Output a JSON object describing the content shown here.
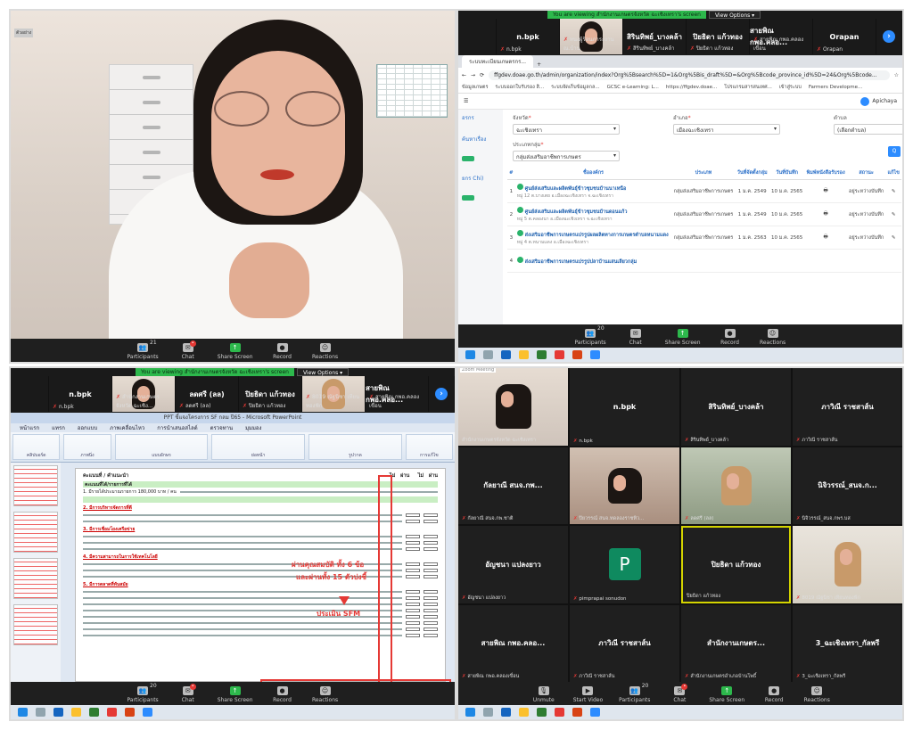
{
  "banner": {
    "sharing_text": "You are viewing สำนักงานเกษตรจังหวัด ฉะเชิงเทรา's screen",
    "view_options": "View Options ▾"
  },
  "zoom_controls": {
    "participants": "Participants",
    "chat": "Chat",
    "share_screen": "Share Screen",
    "record": "Record",
    "reactions": "Reactions",
    "q1_count": "21",
    "q2_count": "20",
    "q3_count": "20",
    "q4_count": "20",
    "start_video": "Start Video",
    "unmute": "Unmute"
  },
  "q1": {
    "tag": "ตัวอย่าง",
    "name_tag": "Hanna"
  },
  "q2": {
    "strip": [
      {
        "name": "",
        "sub": "ทนงผู้ร้อนภาระงาน ณ.บ้าน"
      },
      {
        "name": "n.bpk",
        "sub": "n.bpk"
      },
      {
        "name": "สิรินทิพย์_บางคล้า",
        "sub": "สิรินทิพย์_บางคล้า"
      },
      {
        "name": "ปิยธิดา แก้วทอง",
        "sub": "ปิยธิดา แก้วทอง"
      },
      {
        "name": "สายพิณ กพอ.คลอ...",
        "sub": "สายพิณ กพอ.คลองเขื่อน"
      },
      {
        "name": "Orapan",
        "sub": "Orapan"
      }
    ],
    "tab_title": "ระบบทะเบียนเกษตรกร...",
    "url": "ffgdev.doae.go.th/admin/organization/index?Org%5Bsearch%5D=1&Org%5Bis_draft%5D=&Org%5Bcode_province_id%5D=24&Org%5Bcode...",
    "bookmarks": [
      "ข้อมูลเกษตร",
      "ระบบออกใบรับรอง สิ...",
      "ระบบจัดเก็บข้อมูลกล...",
      "GCSC e-Learning: L...",
      "https://ffgdev.doae...",
      "โปรแกรมสารสนเทศ...",
      "เข้าสู่ระบบ",
      "Farmers Developme..."
    ],
    "user_name": "Apichaya",
    "user_role": "กษตร ฉะเชิงเทรา",
    "sidebar": [
      "อรกร",
      "ค้นหาเรื่อง",
      "ยกร Chi)"
    ],
    "labels": {
      "province": "จังหวัด",
      "district": "อำเภอ",
      "subdistrict": "ตำบล",
      "group_type": "ประเภทกลุ่ม"
    },
    "values": {
      "province": "ฉะเชิงเทรา",
      "district": "เมืองฉะเชิงเทรา",
      "subdistrict": "(เลือกตำบล)",
      "group_type": "กลุ่มส่งเสริมอาชีพการเกษตร"
    },
    "search_btn": "Q",
    "headers": [
      "#",
      "ชื่อองค์กร",
      "ประเภท",
      "วันที่จัดตั้งกลุ่ม",
      "วันที่บันทึก",
      "พิมพ์หนังสือรับรอง",
      "สถานะ",
      "แก้ไข"
    ],
    "rows": [
      {
        "no": "1",
        "name": "ศูนย์ส่งเสริมและผลิตพันธุ์ข้าวชุมชนบ้านนาเหนือ",
        "addr": "หมู่ 12 ต.บางเตย อ.เมืองฉะเชิงเทรา จ.ฉะเชิงเทรา",
        "type": "กลุ่มส่งเสริมอาชีพการเกษตร",
        "est": "1 ม.ค. 2549",
        "saved": "10 ม.ค. 2565",
        "status": "อยู่ระหว่างบันทึก"
      },
      {
        "no": "2",
        "name": "ศูนย์ส่งเสริมและผลิตพันธุ์ข้าวชุมชนบ้านดอนแก้ว",
        "addr": "หมู่ 5 ต.คลองนา อ.เมืองฉะเชิงเทรา จ.ฉะเชิงเทรา",
        "type": "กลุ่มส่งเสริมอาชีพการเกษตร",
        "est": "1 ม.ค. 2549",
        "saved": "10 ม.ค. 2565",
        "status": "อยู่ระหว่างบันทึก"
      },
      {
        "no": "3",
        "name": "ส่งเสริมอาชีพการเกษตรแปรรูปผลผลิตทางการเกษตรตำบลหนามแดง",
        "addr": "หมู่ 4 ต.หนามแดง อ.เมืองฉะเชิงเทรา",
        "type": "กลุ่มส่งเสริมอาชีพการเกษตร",
        "est": "1 ม.ค. 2563",
        "saved": "10 ม.ค. 2565",
        "status": "อยู่ระหว่างบันทึก"
      },
      {
        "no": "4",
        "name": "ส่งเสริมอาชีพการเกษตรแปรรูปปลาบ้านแสนเลียวกลุ่ม",
        "addr": "",
        "type": "",
        "est": "",
        "saved": "",
        "status": ""
      }
    ]
  },
  "q3": {
    "strip": [
      {
        "name": "",
        "sub": "สำนักงานเกษตรจังหวัด ฉะเชิง..."
      },
      {
        "name": "n.bpk",
        "sub": "n.bpk"
      },
      {
        "name": "ลดศรี (ลล)",
        "sub": "ลดศรี (ลล)"
      },
      {
        "name": "ปิยธิดา แก้วทอง",
        "sub": "ปิยธิดา แก้วทอง"
      },
      {
        "name": "",
        "sub": "8019 ณัฐนิชา เทียนทองฟัก"
      },
      {
        "name": "สายพิณ กพอ.คลอ...",
        "sub": "สายพิณ กพอ.คลองเขื่อน"
      }
    ],
    "ppt_title": "PPT ชี้แจงโครงการ SF กลม ปี65 - Microsoft PowerPoint",
    "ribbon_tabs": [
      "หน้าแรก",
      "แทรก",
      "ออกแบบ",
      "ภาพเคลื่อนไหว",
      "การนำเสนอสไลด์",
      "ตรวจทาน",
      "มุมมอง"
    ],
    "ribbon_groups": [
      "คลิปบอร์ด",
      "ภาพนิ่ง",
      "แบบอักษร",
      "ย่อหน้า",
      "รูปวาด",
      "การแก้ไข"
    ],
    "slide_title": "คะแนนที่ / คำแนะนำ",
    "slide_sections": [
      "คะแนนที่ได้/รายการที่ได้",
      "1. มีรายได้ประมาณรายการ 180,000 บาท / คน",
      "2. มีการบริหารจัดการที่ดี",
      "3. มีการเชื่อมโยงเครือข่าย",
      "4. มีความสามารถในการใช้เทคโนโลยี",
      "5. มีการตลาดที่ทันสมัย"
    ],
    "note1": "ผ่านคุณสมบัติ ทั้ง 6 ข้อ",
    "note2": "และผ่านทั้ง 15 ตัวบ่งชี้",
    "note3": "ประเมิน SFM"
  },
  "q4": {
    "meeting_label": "Zoom Meeting",
    "tiles": [
      {
        "name": "",
        "sub": "สำนักงานเกษตรจังหวัด ฉะเชิงเทรา",
        "kind": "vid1"
      },
      {
        "name": "n.bpk",
        "sub": "n.bpk",
        "kind": ""
      },
      {
        "name": "สิรินทิพย์_บางคล้า",
        "sub": "สิรินทิพย์_บางคล้า",
        "kind": ""
      },
      {
        "name": "ภาวิณี ราชสาส์น",
        "sub": "ภาวิณี ราชสาส์น",
        "kind": ""
      },
      {
        "name": "กัลยาณี สนจ.กพ...",
        "sub": "กัลยาณี สนจ.กพ.ชาติ",
        "kind": ""
      },
      {
        "name": "",
        "sub": "ปิยวรรณ์ สนจ.ทดลองราชทิว...",
        "kind": "vid2"
      },
      {
        "name": "",
        "sub": "ลดศรี (ลล)",
        "kind": "vid3"
      },
      {
        "name": "นิจิวรรณ์_สนจ.ก...",
        "sub": "นิจิวรรณ์_สนจ.กพร.บส",
        "kind": ""
      },
      {
        "name": "อัญชนา แปลงยาว",
        "sub": "อัญชนา แปลงยาว",
        "kind": ""
      },
      {
        "name": "P",
        "sub": "pimprapai sonudon",
        "kind": "avatar"
      },
      {
        "name": "ปิยธิดา แก้วทอง",
        "sub": "ปิยธิดา แก้วทอง",
        "kind": "active"
      },
      {
        "name": "",
        "sub": "8019 ณัฐนิชา เทียนทองฟัก",
        "kind": "vid4"
      },
      {
        "name": "สายพิณ กพอ.คลอ...",
        "sub": "สายพิณ กพอ.คลองเขื่อน",
        "kind": ""
      },
      {
        "name": "ภาวิณี ราชสาส์น",
        "sub": "ภาวิณี ราชสาส์น",
        "kind": ""
      },
      {
        "name": "สำนักงานเกษตร...",
        "sub": "สำนักงานเกษตรอำเภอบ้านโพธิ์",
        "kind": ""
      },
      {
        "name": "3_ฉะเชิงเทรา_กัลพรี",
        "sub": "3_ฉะเชิงเทรา_กัลพรี",
        "kind": ""
      }
    ]
  }
}
